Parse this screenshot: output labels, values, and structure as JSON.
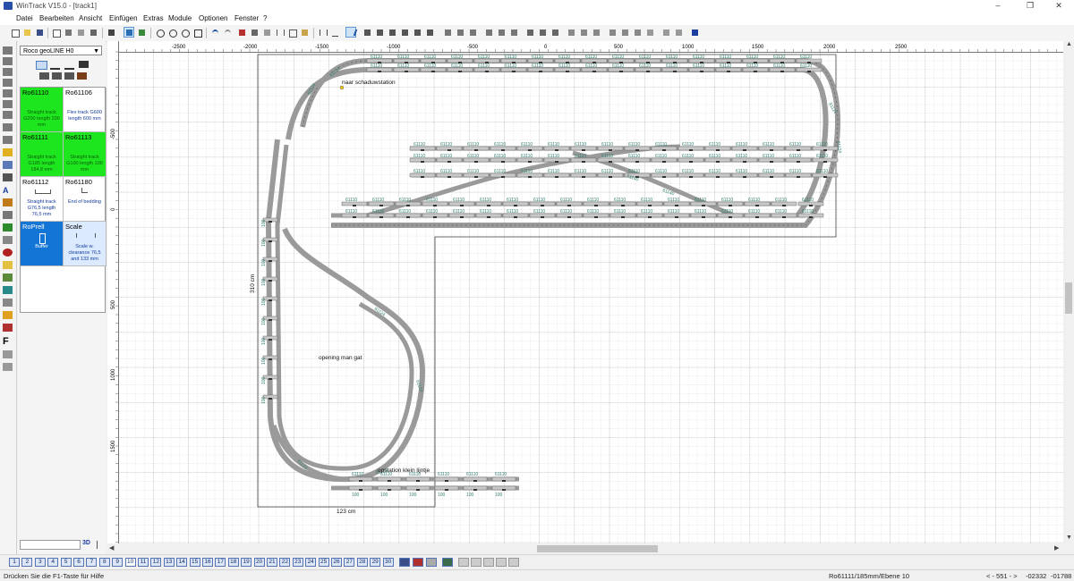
{
  "window": {
    "title": "WinTrack  V15.0 - [track1]",
    "icons": {
      "minimize": "minimize-icon",
      "restore": "restore-icon",
      "close": "close-icon"
    }
  },
  "menu": [
    "Datei",
    "Bearbeiten",
    "Ansicht",
    "Einfügen",
    "Extras",
    "Module",
    "Optionen",
    "Fenster",
    "?"
  ],
  "catalog": {
    "selected_library": "Roco geoLINE H0",
    "tiles": [
      {
        "name": "Ro61110",
        "desc": "Straight track G200 length 200 mm",
        "style": "green"
      },
      {
        "name": "Ro61106",
        "desc": "Flex track G600 length 600 mm",
        "style": "white"
      },
      {
        "name": "Ro61111",
        "desc": "Straight track G185 length 184,8 mm",
        "style": "green"
      },
      {
        "name": "Ro61113",
        "desc": "Straight track G100 length 100 mm",
        "style": "green"
      },
      {
        "name": "Ro61112",
        "desc": "Straight track G76,5 length 76,5 mm",
        "style": "white"
      },
      {
        "name": "Ro61180",
        "desc": "End of bedding",
        "style": "white"
      },
      {
        "name": "RoPrell",
        "desc": "Buffer",
        "style": "blue"
      },
      {
        "name": "Scale",
        "desc": "Scale w. clearance 76,5 and 133 mm",
        "style": "sel"
      }
    ],
    "search_value": "",
    "view_toggle": "3D"
  },
  "ruler": {
    "x_labels": [
      "-2500",
      "-2000",
      "-1500",
      "-1000",
      "-500",
      "0",
      "500",
      "1000",
      "1500",
      "2000",
      "2500"
    ],
    "y_labels": [
      "-500",
      "0",
      "500",
      "1000",
      "1500"
    ]
  },
  "layout": {
    "labels": [
      "naar schaduwstation",
      "opening man gat",
      "opstation klein lijntje",
      "310 cm",
      "123 cm"
    ],
    "straight_code": "61110",
    "short_code": "61111",
    "curve_code": "61124",
    "turnout_code": "61140",
    "segment_length": "100"
  },
  "layers": [
    "1",
    "2",
    "3",
    "4",
    "5",
    "6",
    "7",
    "8",
    "9",
    "10",
    "11",
    "12",
    "13",
    "14",
    "15",
    "16",
    "17",
    "18",
    "19",
    "20",
    "21",
    "22",
    "23",
    "24",
    "25",
    "26",
    "27",
    "28",
    "29",
    "30"
  ],
  "active_layer": "10",
  "status": {
    "hint": "Drücken Sie die  F1-Taste für Hilfe",
    "element": "Ro61111/185mm/Ebene 10",
    "nav": "< - 551 - >",
    "x": "-02332",
    "y": "-01788"
  }
}
